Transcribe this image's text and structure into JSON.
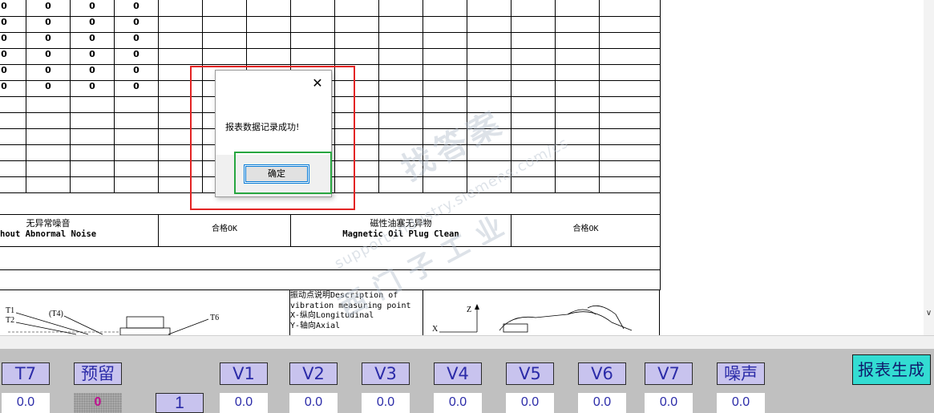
{
  "table": {
    "zero_rows": [
      [
        "0",
        "0",
        "0",
        "0"
      ],
      [
        "0",
        "0",
        "0",
        "0"
      ],
      [
        "0",
        "0",
        "0",
        "0"
      ],
      [
        "0",
        "0",
        "0",
        "0"
      ],
      [
        "0",
        "0",
        "0",
        "0"
      ],
      [
        "0",
        "0",
        "0",
        "0"
      ]
    ],
    "check_items": [
      {
        "cn": "无异常噪音",
        "en": "hout Abnormal Noise",
        "result": "合格OK"
      },
      {
        "cn": "磁性油塞无异物",
        "en": "Magnetic Oil Plug Clean",
        "result": "合格OK"
      }
    ],
    "vibration_description": "振动点说明Description of\nvibration measuring point\nX-纵向Longitudinal\nY-轴向Axial",
    "drawing_labels": {
      "t1": "T1",
      "t2": "T2",
      "t4": "(T4)",
      "t6": "T6",
      "z": "Z",
      "x": "X"
    }
  },
  "watermark": {
    "line1": "找答案",
    "line2": "support.industry.siemens.com/cs",
    "line3": "西门子工业"
  },
  "dialog": {
    "close_symbol": "✕",
    "message": "报表数据记录成功!",
    "ok_label": "确定"
  },
  "panel": {
    "tags": {
      "t7": "T7",
      "reserve": "预留",
      "v1": "V1",
      "v2": "V2",
      "v3": "V3",
      "v4": "V4",
      "v5": "V5",
      "v6": "V6",
      "v7": "V7",
      "noise": "噪声"
    },
    "values": {
      "t7": "0.0",
      "reserve": "0",
      "one": "1",
      "v1": "0.0",
      "v2": "0.0",
      "v3": "0.0",
      "v4": "0.0",
      "v5": "0.0",
      "v6": "0.0",
      "v7": "0.0",
      "noise": "0.0"
    },
    "generate_label": "报表生成"
  },
  "scrollbar": {
    "down_arrow": "∨"
  },
  "colors": {
    "tag_bg": "#c8c3ee",
    "tag_text": "#2b2ba8",
    "button_bg": "#33dcd2",
    "panel_bg": "#c0c0c0",
    "red_highlight": "#e32424",
    "green_highlight": "#27a640"
  }
}
